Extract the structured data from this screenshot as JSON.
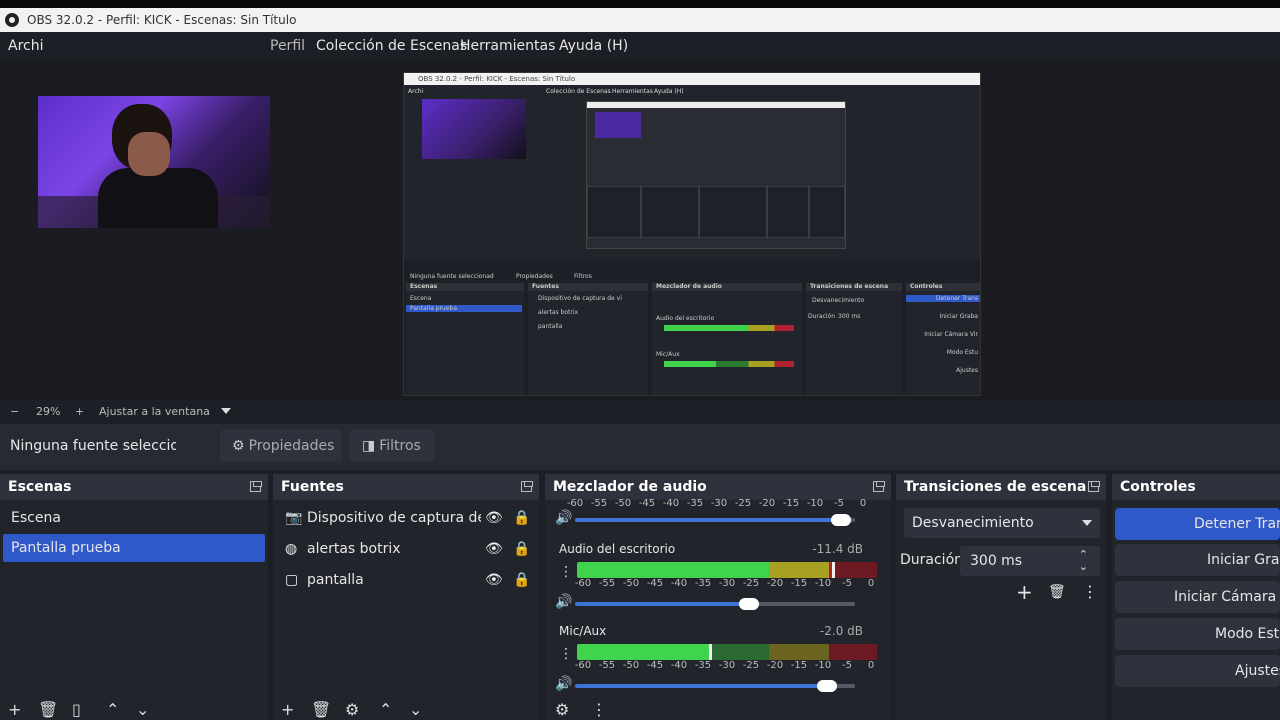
{
  "window": {
    "title": "OBS 32.0.2 - Perfil: KICK - Escenas: Sin Título"
  },
  "menu": [
    {
      "label": "Archi"
    },
    {
      "label": "Perfil"
    },
    {
      "label": "Colección de Escenas"
    },
    {
      "label": "Herramientas"
    },
    {
      "label": "Ayuda (H)"
    }
  ],
  "nested_preview": {
    "title": "OBS 32.0.2 - Perfil: KICK - Escenas: Sin Título",
    "menu": [
      "Archi",
      "Colección de Escenas",
      "Herramientas",
      "Ayuda (H)"
    ],
    "nosel": "Ninguna fuente seleccionad",
    "props": "Propiedades",
    "filters": "Filtros",
    "panels": [
      "Escenas",
      "Fuentes",
      "Mezclador de audio",
      "Transiciones de escena",
      "Controles"
    ],
    "scenes": [
      "Escena",
      "Pantalla prueba"
    ],
    "sources": [
      "Dispositivo de captura de vi",
      "alertas botrix",
      "pantalla"
    ],
    "channels": [
      "Audio del escritorio",
      "Mic/Aux"
    ],
    "transition": "Desvanecimiento",
    "duration_label": "Duración",
    "duration": "300 ms",
    "controls": [
      "Detener Trans",
      "Iniciar Graba",
      "Iniciar Cámara Vir",
      "Modo Estu",
      "Ajustes"
    ]
  },
  "zoom": {
    "minus": "−",
    "value": "29%",
    "plus": "+",
    "fit": "Ajustar a la ventana"
  },
  "infobar": {
    "no_selection": "Ninguna fuente seleccionad",
    "properties": "Propiedades",
    "filters": "Filtros"
  },
  "scenes": {
    "title": "Escenas",
    "items": [
      {
        "label": "Escena",
        "selected": false
      },
      {
        "label": "Pantalla prueba",
        "selected": true
      }
    ]
  },
  "sources": {
    "title": "Fuentes",
    "items": [
      {
        "label": "Dispositivo de captura de vi",
        "icon": "camera-icon"
      },
      {
        "label": "alertas botrix",
        "icon": "globe-icon"
      },
      {
        "label": "pantalla",
        "icon": "monitor-icon"
      }
    ]
  },
  "mixer": {
    "title": "Mezclador de audio",
    "scale": [
      "-60",
      "-55",
      "-50",
      "-45",
      "-40",
      "-35",
      "-30",
      "-25",
      "-20",
      "-15",
      "-10",
      "-5",
      "0"
    ],
    "top_volume": 0.95,
    "channels": [
      {
        "name": "Audio del escritorio",
        "db": "-11.4 dB",
        "level": 0.86,
        "volume": 0.62
      },
      {
        "name": "Mic/Aux",
        "db": "-2.0 dB",
        "level": 0.45,
        "volume": 0.9
      }
    ]
  },
  "transitions": {
    "title": "Transiciones de escena",
    "selected": "Desvanecimiento",
    "duration_label": "Duración",
    "duration": "300 ms"
  },
  "controls": {
    "title": "Controles",
    "buttons": [
      "Detener Transm",
      "Iniciar Grabac",
      "Iniciar Cámara Virt",
      "Modo Estudi",
      "Ajustes"
    ]
  },
  "colors": {
    "accent": "#2f58c9",
    "meter_green": "#3fd44b",
    "meter_yellow": "#a8a020",
    "meter_red": "#b02230"
  }
}
